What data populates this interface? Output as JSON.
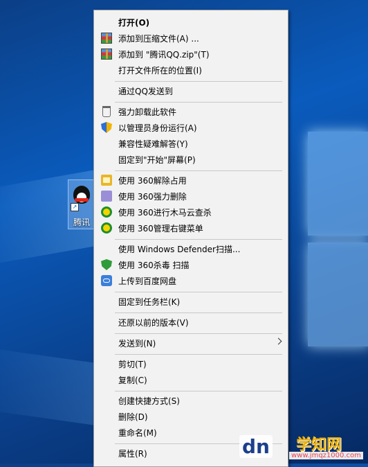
{
  "desktop": {
    "icon_label": "腾讯"
  },
  "menu": {
    "items": [
      {
        "label": "打开(O)",
        "icon": "none",
        "bold": true
      },
      {
        "label": "添加到压缩文件(A) ...",
        "icon": "winrar-icon"
      },
      {
        "label": "添加到 \"腾讯QQ.zip\"(T)",
        "icon": "winrar-icon"
      },
      {
        "label": "打开文件所在的位置(I)",
        "icon": "none"
      },
      {
        "label": "通过QQ发送到",
        "icon": "none"
      },
      {
        "label": "强力卸载此软件",
        "icon": "trash-icon"
      },
      {
        "label": "以管理员身份运行(A)",
        "icon": "uac-shield-icon"
      },
      {
        "label": "兼容性疑难解答(Y)",
        "icon": "none"
      },
      {
        "label": "固定到\"开始\"屏幕(P)",
        "icon": "none"
      },
      {
        "label": "使用 360解除占用",
        "icon": "360-unlock-icon"
      },
      {
        "label": "使用 360强力删除",
        "icon": "360-delete-icon"
      },
      {
        "label": "使用 360进行木马云查杀",
        "icon": "360-scan-icon"
      },
      {
        "label": "使用 360管理右键菜单",
        "icon": "360-menu-icon"
      },
      {
        "label": "使用 Windows Defender扫描...",
        "icon": "none"
      },
      {
        "label": "使用 360杀毒 扫描",
        "icon": "360-antivirus-icon"
      },
      {
        "label": "上传到百度网盘",
        "icon": "baidu-cloud-icon"
      },
      {
        "label": "固定到任务栏(K)",
        "icon": "none"
      },
      {
        "label": "还原以前的版本(V)",
        "icon": "none"
      },
      {
        "label": "发送到(N)",
        "icon": "none",
        "submenu": true
      },
      {
        "label": "剪切(T)",
        "icon": "none"
      },
      {
        "label": "复制(C)",
        "icon": "none"
      },
      {
        "label": "创建快捷方式(S)",
        "icon": "none"
      },
      {
        "label": "删除(D)",
        "icon": "none"
      },
      {
        "label": "重命名(M)",
        "icon": "none"
      },
      {
        "label": "属性(R)",
        "icon": "none"
      }
    ]
  },
  "watermark": {
    "logo": "dn",
    "site_name": "学知网",
    "url": "www.jmqz1000.com"
  },
  "colors": {
    "menu_background": "#f2f2f2",
    "separator": "#c8c8c8",
    "desktop_blue": "#0a5bbd"
  }
}
